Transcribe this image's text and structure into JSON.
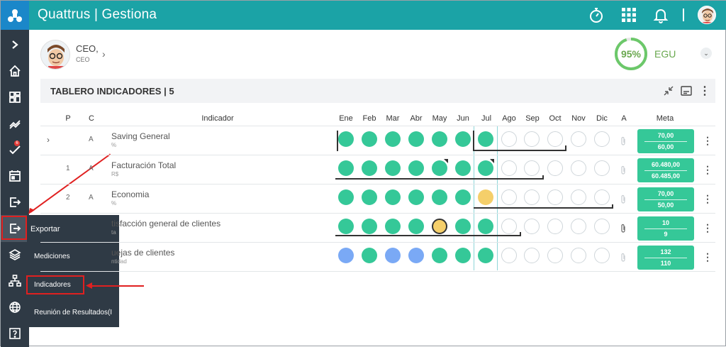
{
  "app": {
    "brand": "Quattrus | Gestiona"
  },
  "icons": {
    "logo": "quattrus-logo-icon",
    "timer": "stopwatch-icon",
    "apps": "grid-icon",
    "notifications": "bell-icon",
    "user": "avatar"
  },
  "sidebar": {
    "items": [
      {
        "name": "expand-icon"
      },
      {
        "name": "home-icon"
      },
      {
        "name": "dashboard-icon"
      },
      {
        "name": "trend-icon"
      },
      {
        "name": "tasks-icon",
        "badge": "6"
      },
      {
        "name": "calendar-icon"
      },
      {
        "name": "import-icon"
      },
      {
        "name": "export-icon"
      },
      {
        "name": "layers-icon"
      },
      {
        "name": "org-chart-icon"
      },
      {
        "name": "globe-icon"
      },
      {
        "name": "help-icon"
      }
    ],
    "flyout": {
      "title": "Exportar",
      "items": [
        "Mediciones",
        "Indicadores",
        "Reunión de Resultados(I"
      ]
    }
  },
  "user": {
    "name": "CEO,",
    "role": "CEO"
  },
  "kpi": {
    "percent": "95%",
    "label": "EGU",
    "value": 0.95,
    "color": "#6cc86a"
  },
  "panel": {
    "title": "TABLERO INDICADORES | 5"
  },
  "table": {
    "headers": [
      "P",
      "C",
      "Indicador",
      "Ene",
      "Feb",
      "Mar",
      "Abr",
      "May",
      "Jun",
      "Jul",
      "Ago",
      "Sep",
      "Oct",
      "Nov",
      "Dic",
      "A",
      "Meta"
    ],
    "rows": [
      {
        "p": "",
        "c": "A",
        "name": "Saving General",
        "unit": "%",
        "dots": [
          "g",
          "g",
          "g",
          "g",
          "g",
          "g",
          "g",
          "e",
          "e",
          "e",
          "e",
          "e"
        ],
        "meta1": "70,00",
        "meta2": "60,00",
        "expand": true
      },
      {
        "p": "1",
        "c": "A",
        "name": "Facturación Total",
        "unit": "R$",
        "dots": [
          "g",
          "g",
          "g",
          "g",
          "g",
          "g",
          "g",
          "e",
          "e",
          "e",
          "e",
          "e"
        ],
        "meta1": "60.480,00",
        "meta2": "60.485,00"
      },
      {
        "p": "2",
        "c": "A",
        "name": "Economia",
        "unit": "%",
        "dots": [
          "g",
          "g",
          "g",
          "g",
          "g",
          "g",
          "y",
          "e",
          "e",
          "e",
          "e",
          "e"
        ],
        "meta1": "70,00",
        "meta2": "50,00"
      },
      {
        "p": "",
        "c": "",
        "name": "tisfacción general de clientes",
        "unit": "ta",
        "dots": [
          "g",
          "g",
          "g",
          "g",
          "yb",
          "g",
          "g",
          "e",
          "e",
          "e",
          "e",
          "e"
        ],
        "meta1": "10",
        "meta2": "9"
      },
      {
        "p": "",
        "c": "",
        "name": "uejas de clientes",
        "unit": "ntidad",
        "dots": [
          "b",
          "g",
          "b",
          "b",
          "g",
          "g",
          "g",
          "e",
          "e",
          "e",
          "e",
          "e"
        ],
        "meta1": "132",
        "meta2": "110"
      }
    ]
  },
  "colors": {
    "teal": "#1ba3a6",
    "green": "#35c898",
    "blue": "#7aa9f5",
    "yellow": "#f5cf6a",
    "sidebar": "#2f3a45",
    "annotation": "#e02020"
  }
}
